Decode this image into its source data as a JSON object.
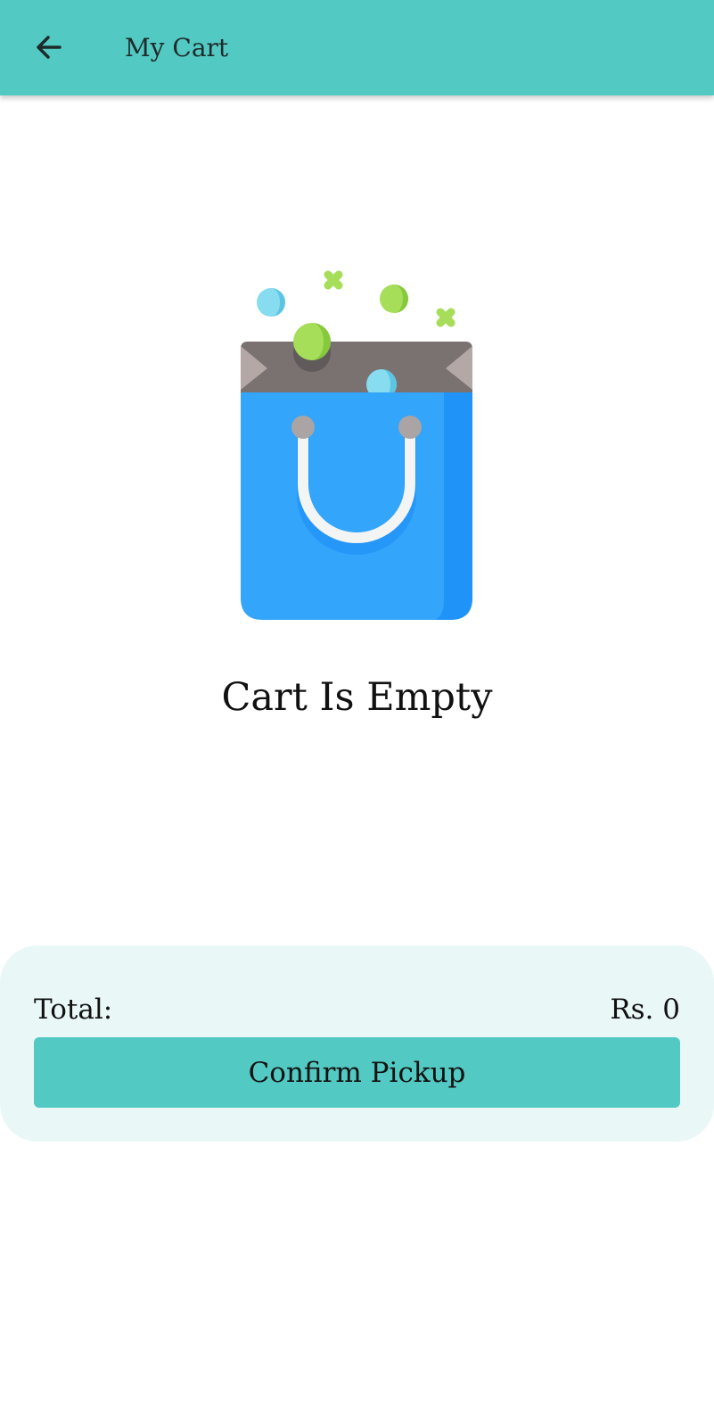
{
  "header": {
    "title": "My Cart",
    "back_icon": "arrow-left-icon"
  },
  "empty_state": {
    "illustration_icon": "shopping-bag-icon",
    "message": "Cart Is Empty"
  },
  "summary": {
    "total_label": "Total:",
    "total_value": "Rs. 0",
    "confirm_label": "Confirm Pickup"
  },
  "colors": {
    "accent": "#52c9c2",
    "panel_bg": "#eaf7f7",
    "bag_blue": "#33a5fb",
    "bag_blue_dark": "#1f93f7"
  }
}
